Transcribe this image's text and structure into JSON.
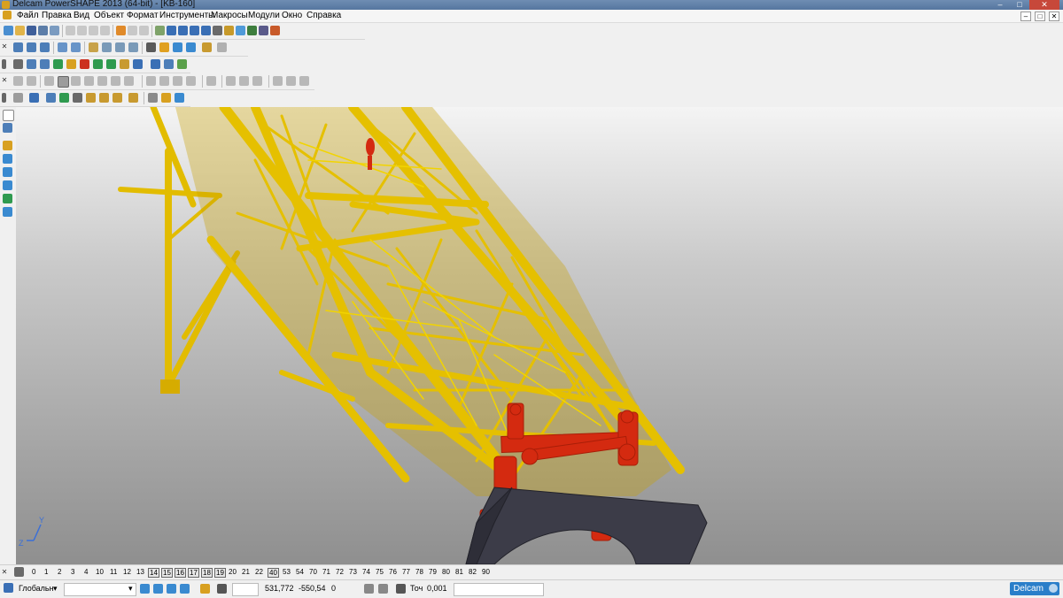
{
  "window": {
    "title": "Delcam PowerSHAPE 2013 (64-bit) - [KB-160]",
    "controls": {
      "minimize": "–",
      "maximize": "□",
      "close": "✕"
    }
  },
  "menu": {
    "items": [
      "Файл",
      "Правка",
      "Вид",
      "Объект",
      "Формат",
      "Инструменты",
      "Макросы",
      "Модули",
      "Окно",
      "Справка"
    ]
  },
  "toolbars": {
    "icon_names": [
      "new-file-icon",
      "open-file-icon",
      "save-icon",
      "print-icon",
      "cut-icon",
      "copy-icon",
      "paste-icon",
      "undo-icon",
      "redo-icon",
      "select-icon",
      "arc-icon",
      "circle-icon",
      "text-icon",
      "shade-icon",
      "zoom-icon",
      "rotate-icon",
      "view-icon",
      "lock-icon"
    ]
  },
  "viewport": {
    "axis_labels": {
      "z": "Z",
      "y": "Y"
    },
    "colors": {
      "frame": "#e5c000",
      "frame_dark": "#b89200",
      "red_part": "#d42a10",
      "base": "#3c3c48"
    }
  },
  "layers": {
    "numbers": [
      "0",
      "1",
      "2",
      "3",
      "4",
      "10",
      "11",
      "12",
      "13",
      "14",
      "15",
      "16",
      "17",
      "18",
      "19",
      "20",
      "21",
      "22",
      "40",
      "53",
      "54",
      "70",
      "71",
      "72",
      "73",
      "74",
      "75",
      "76",
      "77",
      "78",
      "79",
      "80",
      "81",
      "82",
      "90"
    ],
    "boxed": [
      "14",
      "15",
      "16",
      "17",
      "18",
      "19",
      "40"
    ]
  },
  "status": {
    "workplane": "Глобальн",
    "coord_x": "531,772",
    "coord_y": "-550,54",
    "coord_z": "0",
    "tolerance_label": "Точ",
    "tolerance_value": "0,001",
    "brand": "Delcam"
  }
}
